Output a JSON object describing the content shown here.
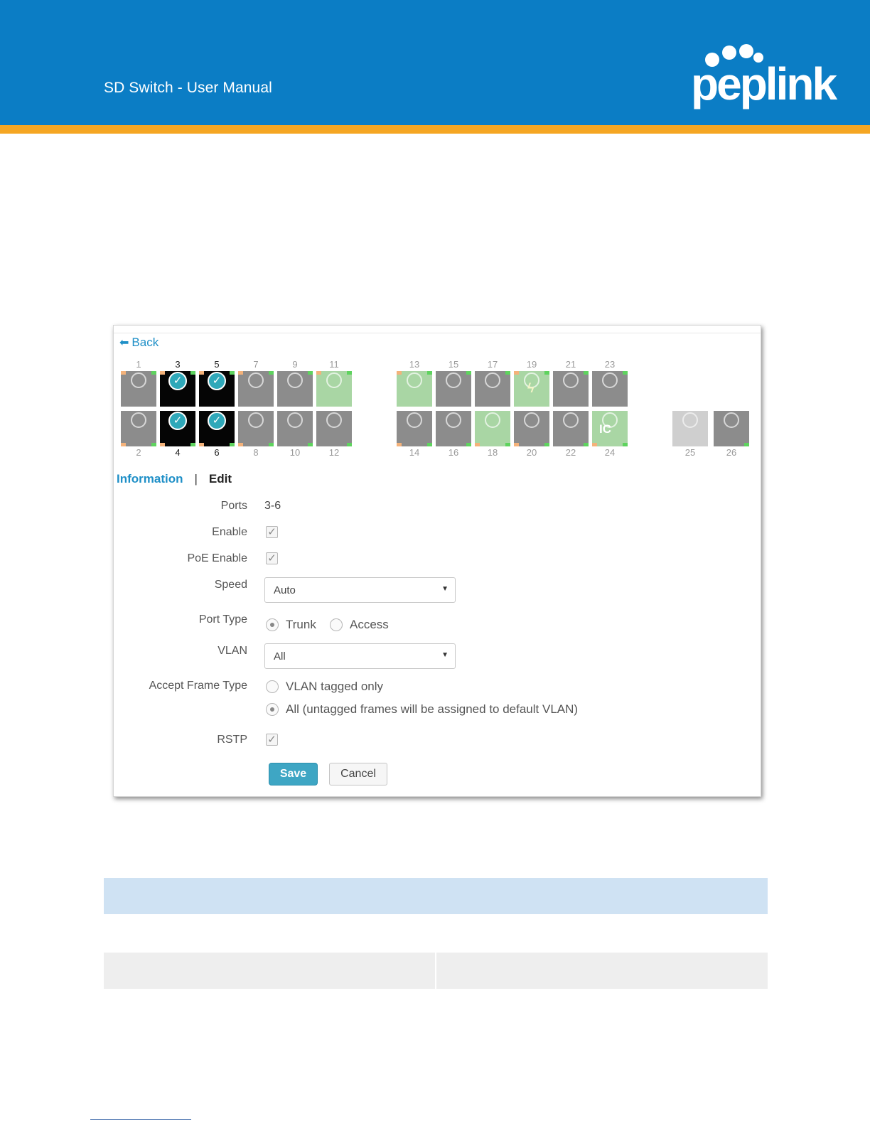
{
  "document": {
    "title": "SD Switch  - User Manual",
    "logo_text": "peplink",
    "colors": {
      "header_blue": "#0b7dc5",
      "accent_orange": "#f5a623",
      "link_blue": "#1e8fc7",
      "save_blue": "#3ea6c4",
      "port_selected": "#050505",
      "port_up": "#a9d6a4",
      "port_idle": "#8c8c8c"
    }
  },
  "ui": {
    "back_label": "Back",
    "ports_top": [
      {
        "num": "1",
        "state": "idle"
      },
      {
        "num": "3",
        "state": "selected"
      },
      {
        "num": "5",
        "state": "selected"
      },
      {
        "num": "7",
        "state": "idle"
      },
      {
        "num": "9",
        "state": "idle"
      },
      {
        "num": "11",
        "state": "up"
      },
      {
        "num": "13",
        "state": "up"
      },
      {
        "num": "15",
        "state": "idle"
      },
      {
        "num": "17",
        "state": "idle"
      },
      {
        "num": "19",
        "state": "poe"
      },
      {
        "num": "21",
        "state": "idle"
      },
      {
        "num": "23",
        "state": "idle"
      }
    ],
    "ports_bottom": [
      {
        "num": "2",
        "state": "idle"
      },
      {
        "num": "4",
        "state": "selected"
      },
      {
        "num": "6",
        "state": "selected"
      },
      {
        "num": "8",
        "state": "idle"
      },
      {
        "num": "10",
        "state": "idle"
      },
      {
        "num": "12",
        "state": "idle"
      },
      {
        "num": "14",
        "state": "idle"
      },
      {
        "num": "16",
        "state": "idle"
      },
      {
        "num": "18",
        "state": "up"
      },
      {
        "num": "20",
        "state": "idle"
      },
      {
        "num": "22",
        "state": "idle"
      },
      {
        "num": "24",
        "state": "ic"
      },
      {
        "num": "25",
        "state": "disabled"
      },
      {
        "num": "26",
        "state": "idle"
      }
    ],
    "port_24_badge": "IC",
    "tabs": {
      "information": "Information",
      "separator": "|",
      "edit": "Edit"
    },
    "form": {
      "ports_label": "Ports",
      "ports_value": "3-6",
      "enable_label": "Enable",
      "enable_checked": true,
      "poe_label": "PoE Enable",
      "poe_checked": true,
      "speed_label": "Speed",
      "speed_value": "Auto",
      "port_type_label": "Port Type",
      "port_type_trunk": "Trunk",
      "port_type_access": "Access",
      "port_type_selected": "Trunk",
      "vlan_label": "VLAN",
      "vlan_value": "All",
      "accept_label": "Accept Frame Type",
      "accept_option_1": "VLAN tagged only",
      "accept_option_2": "All (untagged frames will be assigned to default VLAN)",
      "accept_selected": "All",
      "rstp_label": "RSTP",
      "rstp_checked": true,
      "save_label": "Save",
      "cancel_label": "Cancel"
    }
  }
}
